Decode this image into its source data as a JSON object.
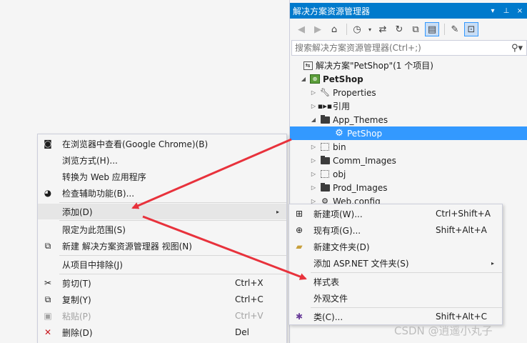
{
  "solution_explorer": {
    "title": "解决方案资源管理器",
    "title_buttons": [
      "▾",
      "⊥",
      "×"
    ],
    "search_placeholder": "搜索解决方案资源管理器(Ctrl+;)",
    "tree": [
      {
        "label": "解决方案\"PetShop\"(1 个项目)",
        "arrow": "",
        "icon": "solution-icon"
      },
      {
        "label": "PetShop",
        "arrow": "◢",
        "icon": "project-icon"
      },
      {
        "label": "Properties",
        "arrow": "▷",
        "icon": "wrench-icon"
      },
      {
        "label": "引用",
        "arrow": "▷",
        "icon": "references-icon"
      },
      {
        "label": "App_Themes",
        "arrow": "◢",
        "icon": "folder-icon"
      },
      {
        "label": "PetShop",
        "arrow": "",
        "icon": "theme-icon"
      },
      {
        "label": "bin",
        "arrow": "▷",
        "icon": "dashed-folder-icon"
      },
      {
        "label": "Comm_Images",
        "arrow": "▷",
        "icon": "folder-icon"
      },
      {
        "label": "obj",
        "arrow": "▷",
        "icon": "dashed-folder-icon"
      },
      {
        "label": "Prod_Images",
        "arrow": "▷",
        "icon": "folder-icon"
      },
      {
        "label": "Web.config",
        "arrow": "▷",
        "icon": "config-icon"
      }
    ]
  },
  "context_menu": {
    "items": [
      {
        "label": "在浏览器中查看(Google Chrome)(B)",
        "shortcut": "",
        "icon": "browser-view-icon"
      },
      {
        "label": "浏览方式(H)...",
        "shortcut": "",
        "icon": ""
      },
      {
        "label": "转换为 Web 应用程序",
        "shortcut": "",
        "icon": ""
      },
      {
        "label": "检查辅助功能(B)...",
        "shortcut": "",
        "icon": "accessibility-check-icon"
      },
      {
        "label": "添加(D)",
        "shortcut": "",
        "icon": "",
        "submenu": "▸"
      },
      {
        "label": "限定为此范围(S)",
        "shortcut": "",
        "icon": ""
      },
      {
        "label": "新建 解决方案资源管理器 视图(N)",
        "shortcut": "",
        "icon": "new-view-icon"
      },
      {
        "label": "从项目中排除(J)",
        "shortcut": "",
        "icon": ""
      },
      {
        "label": "剪切(T)",
        "shortcut": "Ctrl+X",
        "icon": "cut-icon"
      },
      {
        "label": "复制(Y)",
        "shortcut": "Ctrl+C",
        "icon": "copy-icon"
      },
      {
        "label": "粘贴(P)",
        "shortcut": "Ctrl+V",
        "icon": "paste-icon"
      },
      {
        "label": "删除(D)",
        "shortcut": "Del",
        "icon": "delete-icon"
      }
    ]
  },
  "add_submenu": {
    "items": [
      {
        "label": "新建项(W)...",
        "shortcut": "Ctrl+Shift+A",
        "icon": "new-item-icon"
      },
      {
        "label": "现有项(G)...",
        "shortcut": "Shift+Alt+A",
        "icon": "existing-item-icon"
      },
      {
        "label": "新建文件夹(D)",
        "shortcut": "",
        "icon": "new-folder-icon"
      },
      {
        "label": "添加 ASP.NET 文件夹(S)",
        "shortcut": "",
        "icon": "",
        "submenu": "▸"
      },
      {
        "label": "样式表",
        "shortcut": "",
        "icon": ""
      },
      {
        "label": "外观文件",
        "shortcut": "",
        "icon": ""
      },
      {
        "label": "类(C)...",
        "shortcut": "Shift+Alt+C",
        "icon": "class-icon"
      }
    ]
  },
  "watermark": "CSDN @逍遥小丸子",
  "colors": {
    "accent": "#007acc",
    "selection": "#3399ff",
    "arrow": "#e8323c"
  }
}
